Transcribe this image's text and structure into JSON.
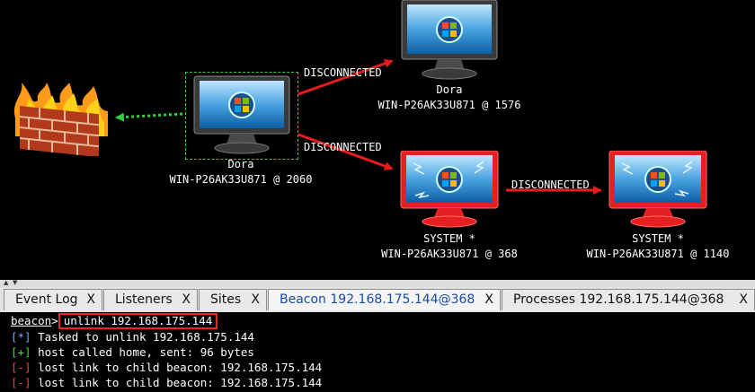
{
  "graph": {
    "edges": [
      {
        "label": "DISCONNECTED"
      },
      {
        "label": "DISCONNECTED"
      },
      {
        "label": "DISCONNECTED"
      }
    ],
    "nodes": [
      {
        "user": "Dora",
        "host": "WIN-P26AK33U871 @ 2060",
        "status": "selected"
      },
      {
        "user": "Dora",
        "host": "WIN-P26AK33U871 @ 1576",
        "status": "normal"
      },
      {
        "user": "SYSTEM *",
        "host": "WIN-P26AK33U871 @ 368",
        "status": "broken"
      },
      {
        "user": "SYSTEM *",
        "host": "WIN-P26AK33U871 @ 1140",
        "status": "broken"
      }
    ],
    "firewall_icon": "firewall-icon"
  },
  "tabs": [
    {
      "label": "Event Log",
      "close": "X"
    },
    {
      "label": "Listeners",
      "close": "X"
    },
    {
      "label": "Sites",
      "close": "X"
    },
    {
      "label": "Beacon 192.168.175.144@368",
      "close": "X"
    },
    {
      "label": "Processes 192.168.175.144@368",
      "close": "X"
    }
  ],
  "active_tab": 3,
  "console": {
    "prompt_user": "beacon",
    "prompt_symbol": ">",
    "command": "unlink 192.168.175.144",
    "lines": [
      {
        "tag": "[*]",
        "text": " Tasked to unlink 192.168.175.144"
      },
      {
        "tag": "[+]",
        "text": " host called home, sent: 96 bytes"
      },
      {
        "tag": "[-]",
        "text": " lost link to child beacon: 192.168.175.144"
      },
      {
        "tag": "[-]",
        "text": " lost link to child beacon: 192.168.175.144"
      }
    ]
  },
  "colors": {
    "link_red": "#e81c1c",
    "pivot_green": "#2ecc40",
    "info_blue": "#6fa8ff",
    "ok_green": "#3ddc3d",
    "err_red": "#ff4040"
  }
}
